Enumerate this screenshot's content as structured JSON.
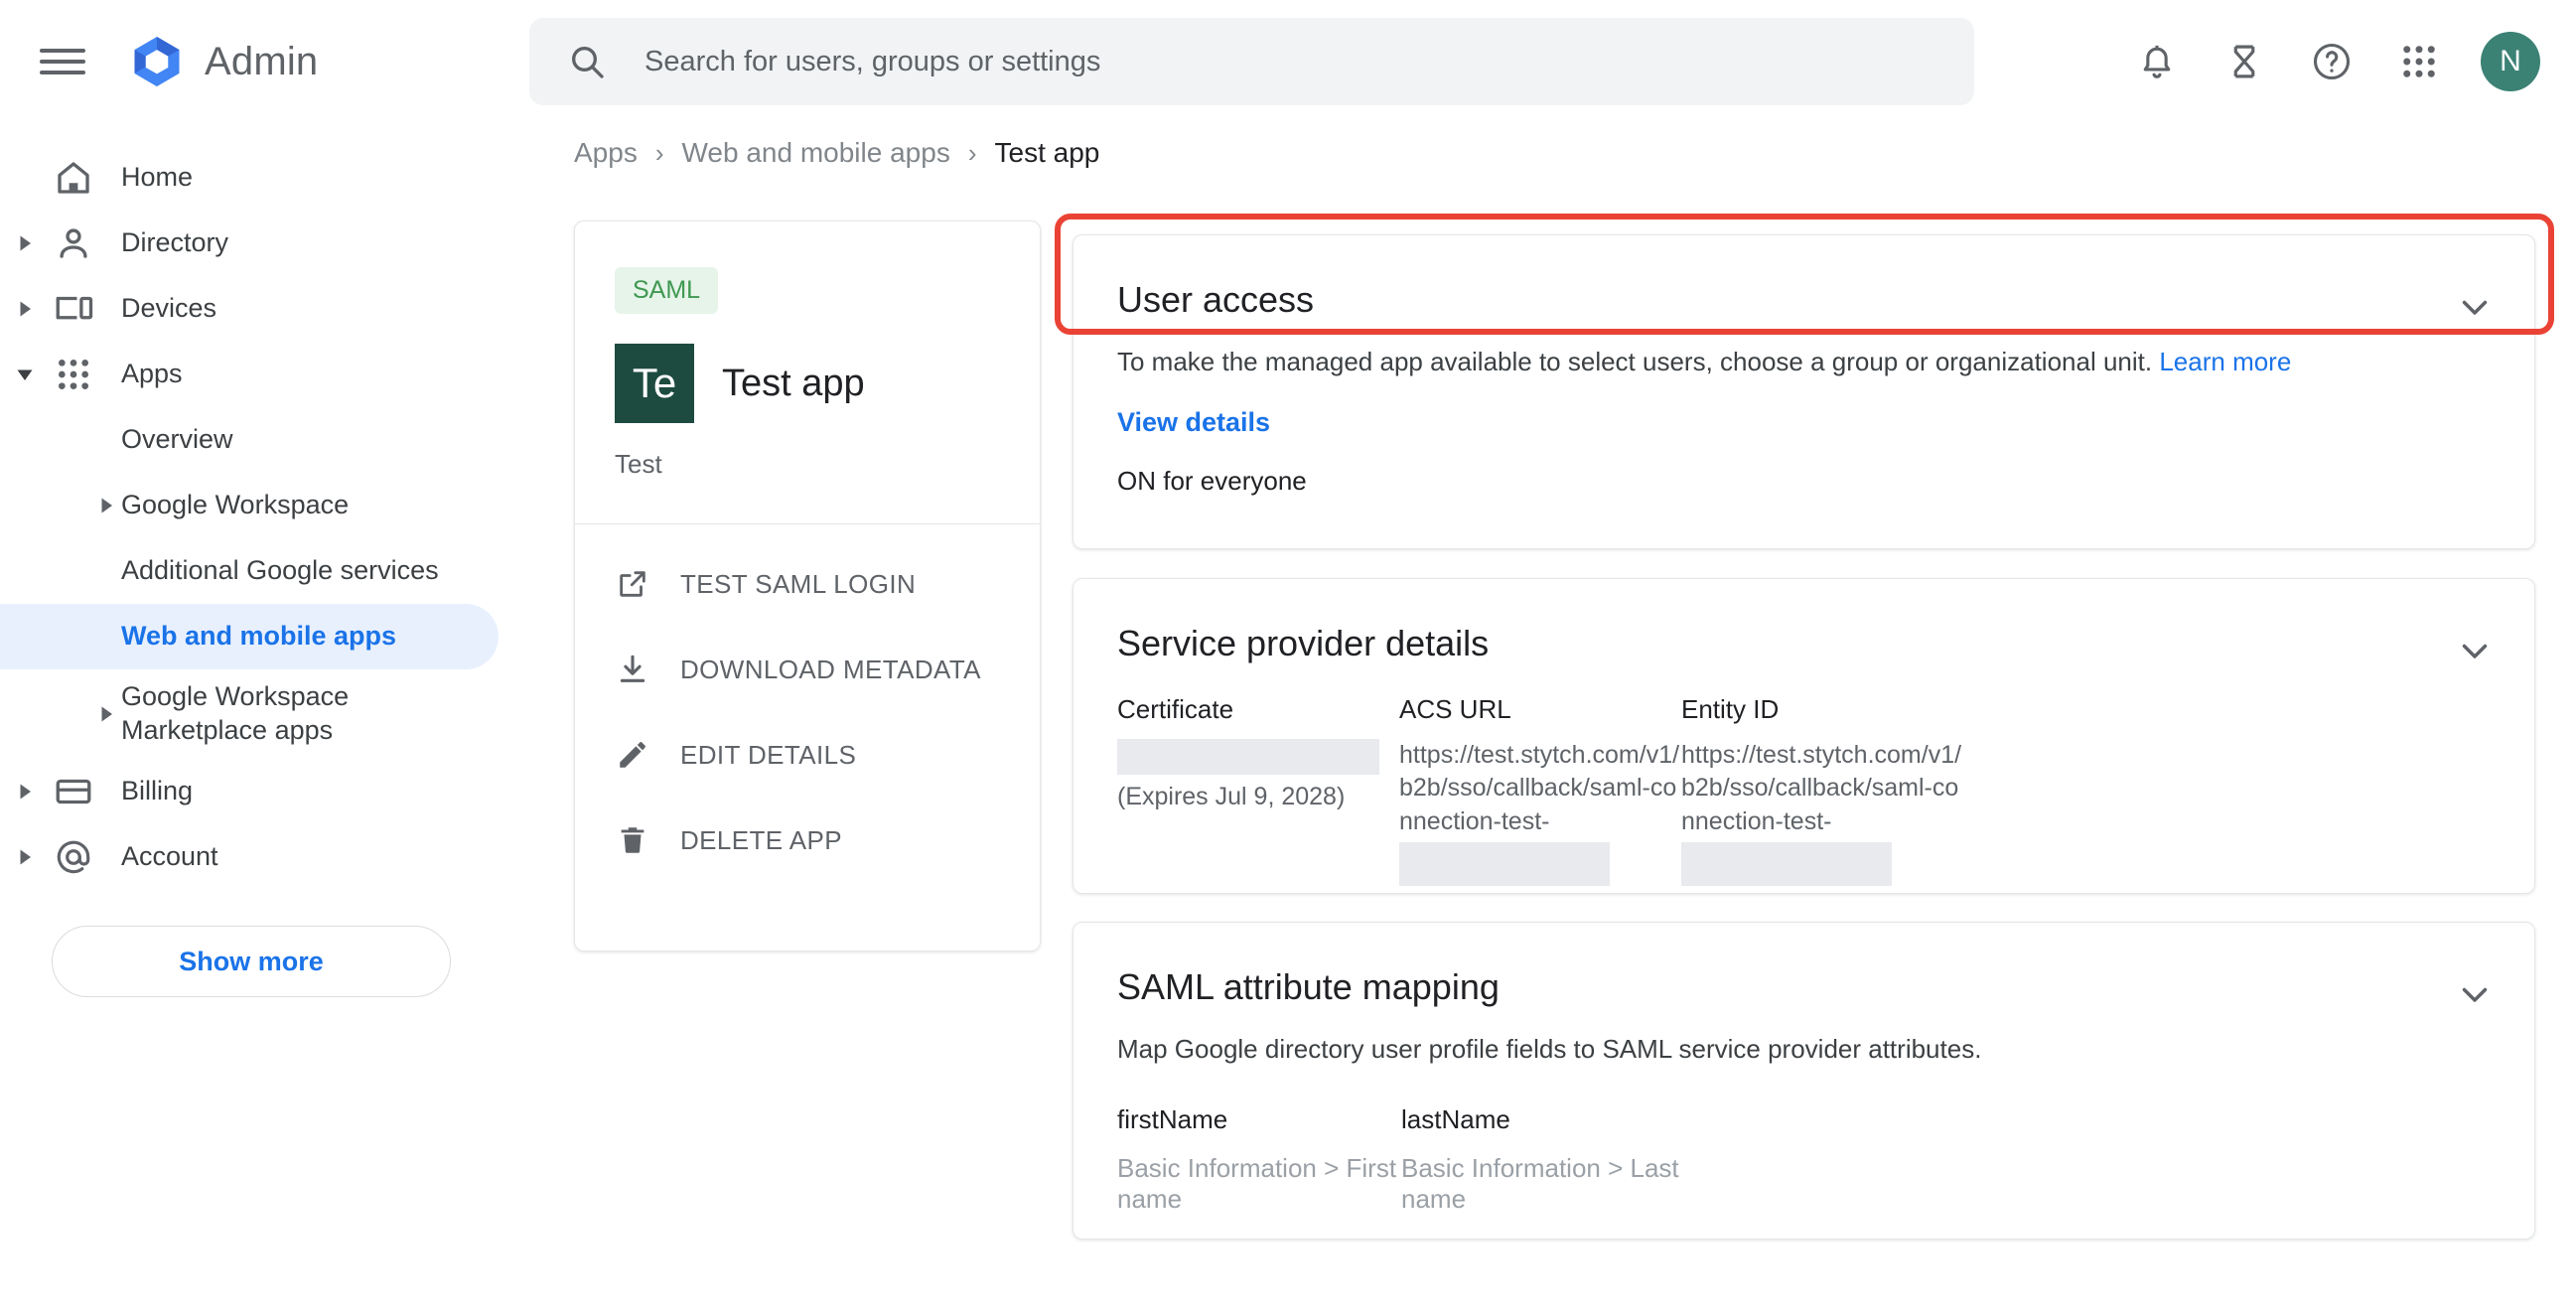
{
  "topbar": {
    "menu_icon": "hamburger-menu-icon",
    "brand": "Admin",
    "brand_logo": "google-admin-logo",
    "search": {
      "placeholder": "Search for users, groups or settings",
      "value": "",
      "icon": "search-icon"
    },
    "icons": [
      {
        "name": "notifications-bell-icon"
      },
      {
        "name": "hourglass-icon"
      },
      {
        "name": "help-question-icon"
      },
      {
        "name": "apps-grid-icon"
      }
    ],
    "avatar_initial": "N",
    "avatar_color": "#3b8275"
  },
  "sidebar": {
    "items": [
      {
        "label": "Home",
        "icon": "home-icon",
        "expandable": false,
        "level": 0
      },
      {
        "label": "Directory",
        "icon": "person-icon",
        "expandable": true,
        "level": 0
      },
      {
        "label": "Devices",
        "icon": "devices-icon",
        "expandable": true,
        "level": 0
      },
      {
        "label": "Apps",
        "icon": "apps-grid-icon",
        "expandable": true,
        "expanded": true,
        "level": 0
      },
      {
        "label": "Overview",
        "icon": "",
        "expandable": false,
        "level": 1
      },
      {
        "label": "Google Workspace",
        "icon": "",
        "expandable": true,
        "level": 1
      },
      {
        "label": "Additional Google services",
        "icon": "",
        "expandable": false,
        "level": 1
      },
      {
        "label": "Web and mobile apps",
        "icon": "",
        "expandable": false,
        "level": 1,
        "active": true
      },
      {
        "label": "Google Workspace Marketplace apps",
        "icon": "",
        "expandable": true,
        "level": 1
      },
      {
        "label": "Billing",
        "icon": "credit-card-icon",
        "expandable": true,
        "level": 0
      },
      {
        "label": "Account",
        "icon": "at-sign-icon",
        "expandable": true,
        "level": 0
      }
    ],
    "show_more_label": "Show more"
  },
  "breadcrumb": {
    "items": [
      "Apps",
      "Web and mobile apps",
      "Test app"
    ],
    "separator": "›"
  },
  "app_card": {
    "badge": "SAML",
    "badge_bg": "#e6f4ea",
    "badge_color": "#3f9850",
    "tile_initials": "Te",
    "tile_bg": "#1d4b40",
    "title": "Test app",
    "subtitle": "Test",
    "actions": [
      {
        "label": "TEST SAML LOGIN",
        "icon": "open-in-new-icon"
      },
      {
        "label": "DOWNLOAD METADATA",
        "icon": "download-icon"
      },
      {
        "label": "EDIT DETAILS",
        "icon": "pencil-edit-icon"
      },
      {
        "label": "DELETE APP",
        "icon": "trash-delete-icon"
      }
    ]
  },
  "user_access": {
    "title": "User access",
    "description": "To make the managed app available to select users, choose a group or organizational unit.",
    "learn_more": "Learn more",
    "view_details": "View details",
    "status": "ON for everyone",
    "chevron": "chevron-down-icon",
    "highlight_color": "#ea4335"
  },
  "service_provider": {
    "title": "Service provider details",
    "chevron": "chevron-down-icon",
    "fields": [
      {
        "label": "Certificate",
        "value": "",
        "redacted": true,
        "note": "(Expires Jul 9, 2028)"
      },
      {
        "label": "ACS URL",
        "value": "https://test.stytch.com/v1/b2b/sso/callback/saml-connection-test-",
        "redacted_suffix": true,
        "note": ""
      },
      {
        "label": "Entity ID",
        "value": "https://test.stytch.com/v1/b2b/sso/callback/saml-connection-test-",
        "redacted_suffix": true,
        "note": ""
      }
    ]
  },
  "attribute_mapping": {
    "title": "SAML attribute mapping",
    "chevron": "chevron-down-icon",
    "description": "Map Google directory user profile fields to SAML service provider attributes.",
    "attributes": [
      {
        "name": "firstName",
        "value": "Basic Information > First name"
      },
      {
        "name": "lastName",
        "value": "Basic Information > Last name"
      }
    ]
  }
}
